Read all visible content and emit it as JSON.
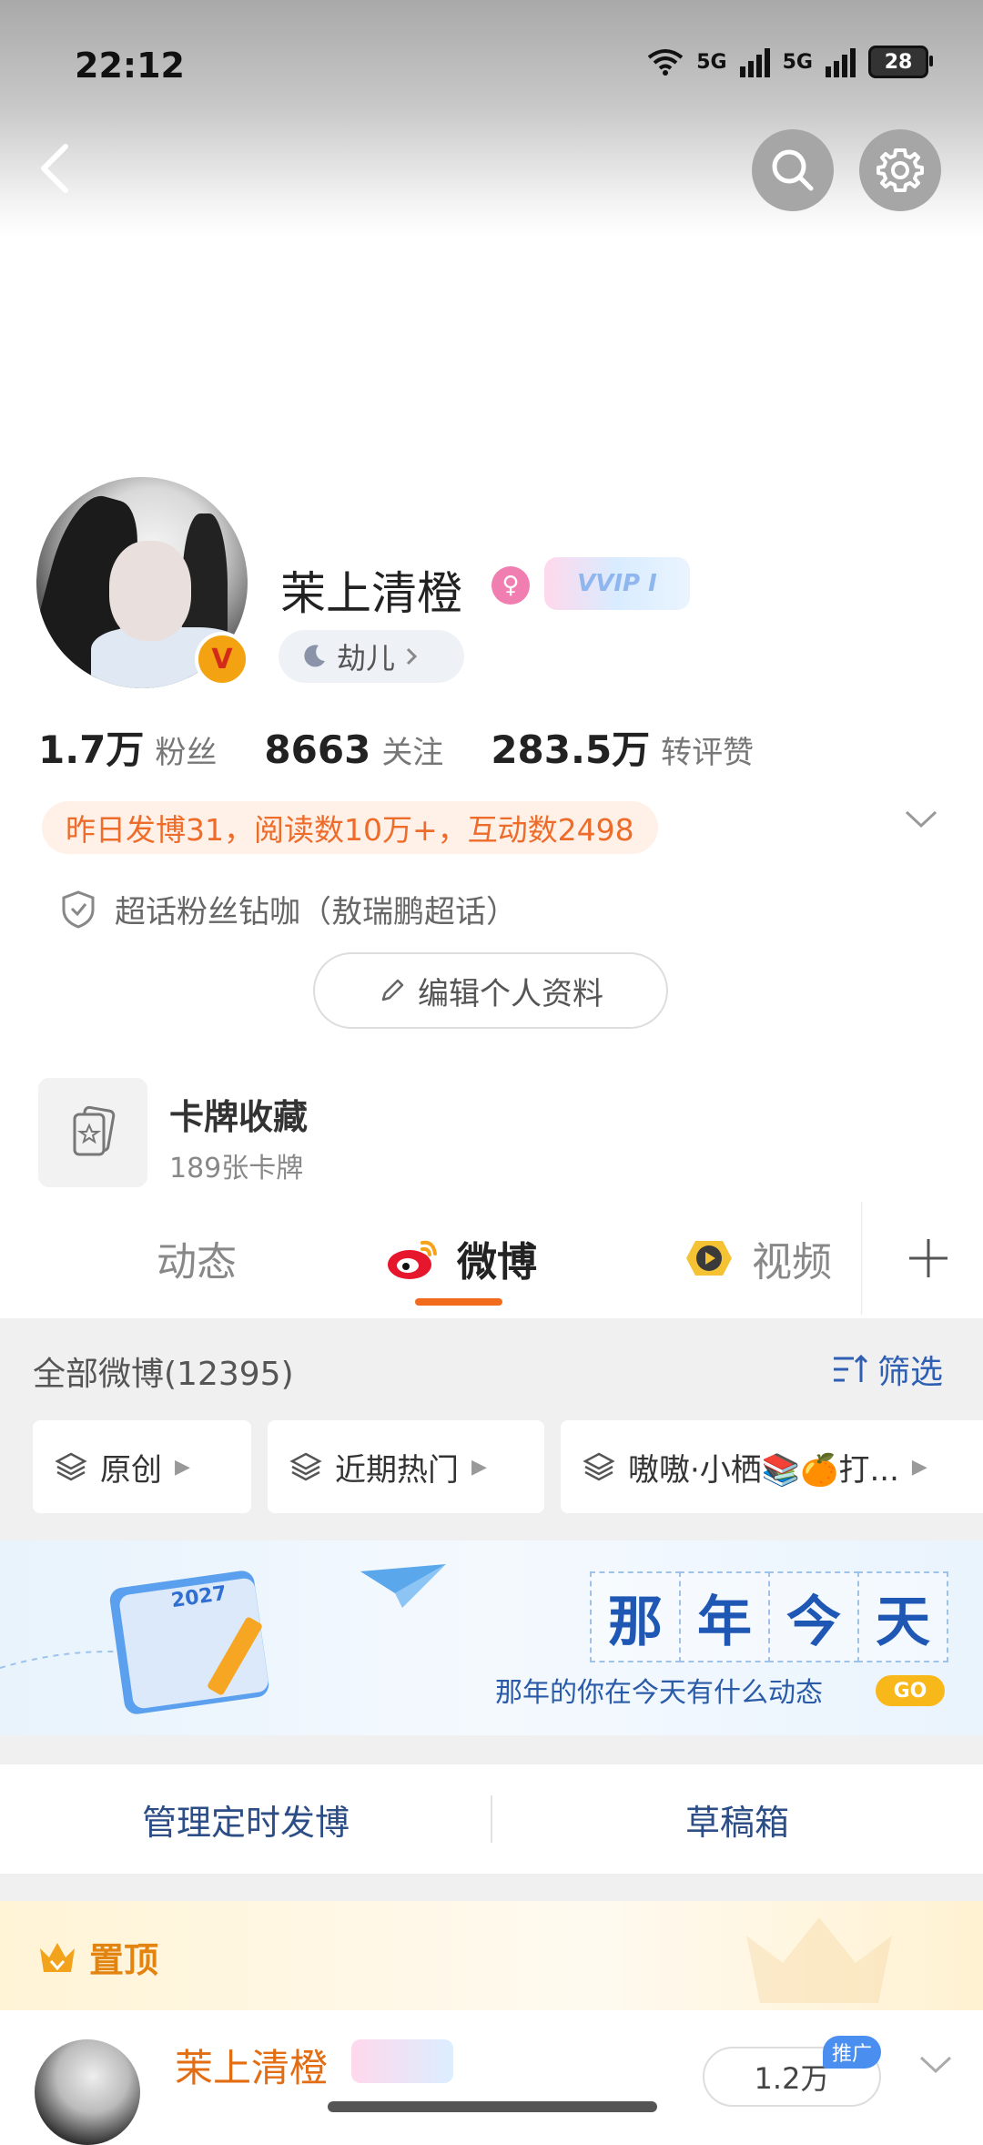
{
  "status_bar": {
    "time": "22:12",
    "net1": "5G",
    "net2": "5G",
    "battery": "28"
  },
  "profile": {
    "name": "茉上清橙",
    "vvip": "VVIP I",
    "level": "劫儿",
    "v_badge": "V",
    "stats": [
      {
        "value": "1.7万",
        "label": "粉丝"
      },
      {
        "value": "8663",
        "label": "关注"
      },
      {
        "value": "283.5万",
        "label": "转评赞"
      }
    ],
    "activity": "昨日发博31，阅读数10万+，互动数2498",
    "supertopic": "超话粉丝钻咖（敖瑞鹏超话）",
    "edit_label": "编辑个人资料"
  },
  "cards": {
    "title": "卡牌收藏",
    "count": "189张卡牌"
  },
  "tabs": [
    {
      "label": "动态"
    },
    {
      "label": "微博"
    },
    {
      "label": "视频"
    }
  ],
  "feed": {
    "all_label": "全部微博(12395)",
    "filter_label": "筛选",
    "chips": [
      "原创",
      "近期热门",
      "嗷嗷·小栖📚🍊打..."
    ]
  },
  "memory": {
    "chars": [
      "那",
      "年",
      "今",
      "天"
    ],
    "subtitle": "那年的你在今天有什么动态",
    "go": "GO",
    "calendar_year": "2027"
  },
  "actions": {
    "manage": "管理定时发博",
    "drafts": "草稿箱"
  },
  "pinned": {
    "label": "置顶",
    "author": "茉上清橙",
    "count": "1.2万",
    "promo": "推广"
  },
  "colors": {
    "accent": "#f26b1d",
    "link": "#2c4d86",
    "activity": "#ee6c2a"
  }
}
